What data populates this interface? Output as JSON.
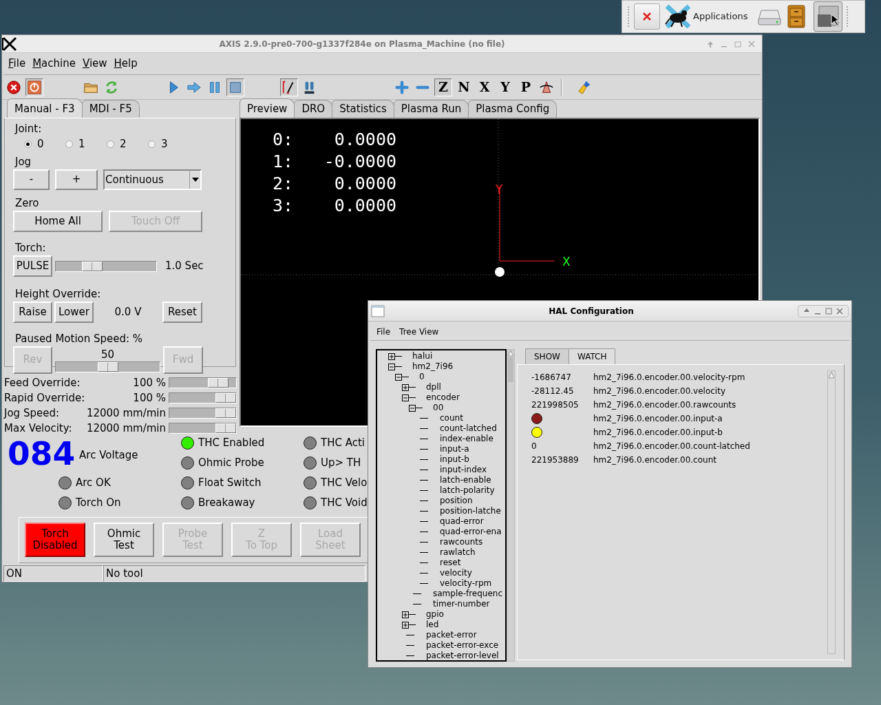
{
  "top_panel": {
    "applications": "Applications"
  },
  "axis_window": {
    "title": "AXIS 2.9.0-pre0-700-g1337f284e on Plasma_Machine (no file)",
    "menu": [
      "File",
      "Machine",
      "View",
      "Help"
    ],
    "toolbar_groups": [
      [
        {
          "kind": "estop",
          "on": false
        },
        {
          "kind": "power",
          "on": true
        }
      ],
      [
        {
          "kind": "open",
          "on": false
        },
        {
          "kind": "reload",
          "on": false
        }
      ],
      [
        {
          "kind": "run",
          "on": false
        },
        {
          "kind": "step",
          "on": false
        },
        {
          "kind": "pause",
          "on": false
        },
        {
          "kind": "stop",
          "on": true
        }
      ],
      [
        {
          "kind": "blockdelete",
          "on": true
        },
        {
          "kind": "optstop",
          "on": false
        }
      ],
      [
        {
          "kind": "zoomin",
          "on": false
        },
        {
          "kind": "zoomout",
          "on": false
        },
        {
          "kind": "view",
          "label": "Z",
          "on": true
        },
        {
          "kind": "view",
          "label": "N",
          "on": false
        },
        {
          "kind": "view",
          "label": "X",
          "on": false
        },
        {
          "kind": "view",
          "label": "Y",
          "on": false
        },
        {
          "kind": "view",
          "label": "P",
          "on": false
        },
        {
          "kind": "rotate",
          "on": false
        }
      ],
      [
        {
          "kind": "clear",
          "on": false
        }
      ]
    ],
    "left_tabs": [
      {
        "label": "Manual - F3",
        "selected": true
      },
      {
        "label": "MDI - F5",
        "selected": false
      }
    ],
    "joint_label": "Joint:",
    "joints": [
      {
        "label": "0",
        "selected": true
      },
      {
        "label": "1",
        "selected": false
      },
      {
        "label": "2",
        "selected": false
      },
      {
        "label": "3",
        "selected": false
      }
    ],
    "jog_label": "Jog",
    "jog_buttons": [
      "-",
      "+"
    ],
    "jog_mode": "Continuous",
    "zero_label": "Zero",
    "zero_buttons": [
      {
        "label": "Home All",
        "disabled": false
      },
      {
        "label": "Touch Off",
        "disabled": true
      }
    ],
    "torch_label": "Torch:",
    "pulse_button": "PULSE",
    "pulse_slider": {
      "level": 0.33
    },
    "pulse_reading": "1.0 Sec",
    "height_label": "Height Override:",
    "raise_button": "Raise",
    "lower_button": "Lower",
    "height_reading": "0.0 V",
    "reset_button": "Reset",
    "paused_label": "Paused Motion Speed: %",
    "rev_button": {
      "label": "Rev",
      "disabled": true
    },
    "paused_reading": "50",
    "paused_slider": {
      "level": 0.5
    },
    "fwd_button": {
      "label": "Fwd",
      "disabled": true
    },
    "overrides": [
      {
        "label": "Feed Override:",
        "value": "100 %",
        "level": 0.84
      },
      {
        "label": "Rapid Override:",
        "value": "100 %",
        "level": 1
      },
      {
        "label": "Jog Speed:",
        "value": "12000 mm/min",
        "level": 1
      },
      {
        "label": "Max Velocity:",
        "value": "12000 mm/min",
        "level": 1
      }
    ],
    "preview_tabs": [
      {
        "label": "Preview",
        "selected": true
      },
      {
        "label": "DRO",
        "selected": false
      },
      {
        "label": "Statistics",
        "selected": false
      },
      {
        "label": "Plasma Run",
        "selected": false
      },
      {
        "label": "Plasma Config",
        "selected": false
      }
    ],
    "dro": [
      {
        "axis": "0:",
        "value": "0.0000"
      },
      {
        "axis": "1:",
        "value": "-0.0000"
      },
      {
        "axis": "2:",
        "value": "0.0000"
      },
      {
        "axis": "3:",
        "value": "0.0000"
      }
    ],
    "axis_labels": {
      "y": "Y",
      "x": "X"
    },
    "arc_voltage": "084",
    "arc_voltage_label": "Arc Voltage",
    "indicator_columns": [
      [
        {
          "label": "Arc OK",
          "color": "#808080"
        },
        {
          "label": "Torch On",
          "color": "#808080"
        }
      ],
      [
        {
          "label": "THC Enabled",
          "color": "#33ee00"
        },
        {
          "label": "Ohmic Probe",
          "color": "#808080"
        },
        {
          "label": "Float Switch",
          "color": "#808080"
        },
        {
          "label": "Breakaway",
          "color": "#808080"
        }
      ],
      [
        {
          "label": "THC Acti",
          "color": "#808080"
        },
        {
          "label": "Up> TH",
          "color": "#808080"
        },
        {
          "label": "THC Velo",
          "color": "#808080"
        },
        {
          "label": "THC Void",
          "color": "#808080"
        }
      ]
    ],
    "action_buttons": [
      {
        "label": "Torch\nDisabled",
        "kind": "alert",
        "disabled": false
      },
      {
        "label": "Ohmic\nTest",
        "kind": "normal",
        "disabled": false
      },
      {
        "label": "Probe\nTest",
        "kind": "normal",
        "disabled": true
      },
      {
        "label": "Z\nTo Top",
        "kind": "normal",
        "disabled": true
      },
      {
        "label": "Load\nSheet",
        "kind": "normal",
        "disabled": true
      }
    ],
    "status_bar": [
      "ON",
      "No tool"
    ]
  },
  "hal_window": {
    "title": "HAL Configuration",
    "menu": [
      "File",
      "Tree View"
    ],
    "tree": [
      {
        "label": "halui",
        "expanded": false
      },
      {
        "label": "hm2_7i96",
        "expanded": true,
        "children": [
          {
            "label": "0",
            "expanded": true,
            "children": [
              {
                "label": "dpll",
                "expanded": false
              },
              {
                "label": "encoder",
                "expanded": true,
                "children": [
                  {
                    "label": "00",
                    "expanded": true,
                    "children": [
                      {
                        "label": "count"
                      },
                      {
                        "label": "count-latched"
                      },
                      {
                        "label": "index-enable"
                      },
                      {
                        "label": "input-a"
                      },
                      {
                        "label": "input-b"
                      },
                      {
                        "label": "input-index"
                      },
                      {
                        "label": "latch-enable"
                      },
                      {
                        "label": "latch-polarity"
                      },
                      {
                        "label": "position"
                      },
                      {
                        "label": "position-latche"
                      },
                      {
                        "label": "quad-error"
                      },
                      {
                        "label": "quad-error-ena"
                      },
                      {
                        "label": "rawcounts"
                      },
                      {
                        "label": "rawlatch"
                      },
                      {
                        "label": "reset"
                      },
                      {
                        "label": "velocity"
                      },
                      {
                        "label": "velocity-rpm"
                      }
                    ]
                  },
                  {
                    "label": "sample-frequenc"
                  },
                  {
                    "label": "timer-number"
                  }
                ]
              },
              {
                "label": "gpio",
                "expanded": false
              },
              {
                "label": "led",
                "expanded": false
              },
              {
                "label": "packet-error"
              },
              {
                "label": "packet-error-exce"
              },
              {
                "label": "packet-error-level"
              }
            ]
          }
        ]
      }
    ],
    "tabs": [
      {
        "label": "SHOW",
        "selected": false
      },
      {
        "label": "WATCH",
        "selected": true
      }
    ],
    "watch": [
      {
        "kind": "value",
        "value": "-1686747",
        "pin": "hm2_7i96.0.encoder.00.velocity-rpm"
      },
      {
        "kind": "value",
        "value": "-28112.45",
        "pin": "hm2_7i96.0.encoder.00.velocity"
      },
      {
        "kind": "value",
        "value": "221998505",
        "pin": "hm2_7i96.0.encoder.00.rawcounts"
      },
      {
        "kind": "bit",
        "color": "#8b1a1a",
        "pin": "hm2_7i96.0.encoder.00.input-a"
      },
      {
        "kind": "bit",
        "color": "#ffff00",
        "pin": "hm2_7i96.0.encoder.00.input-b"
      },
      {
        "kind": "value",
        "value": "0",
        "pin": "hm2_7i96.0.encoder.00.count-latched"
      },
      {
        "kind": "value",
        "value": "221953889",
        "pin": "hm2_7i96.0.encoder.00.count"
      }
    ]
  }
}
